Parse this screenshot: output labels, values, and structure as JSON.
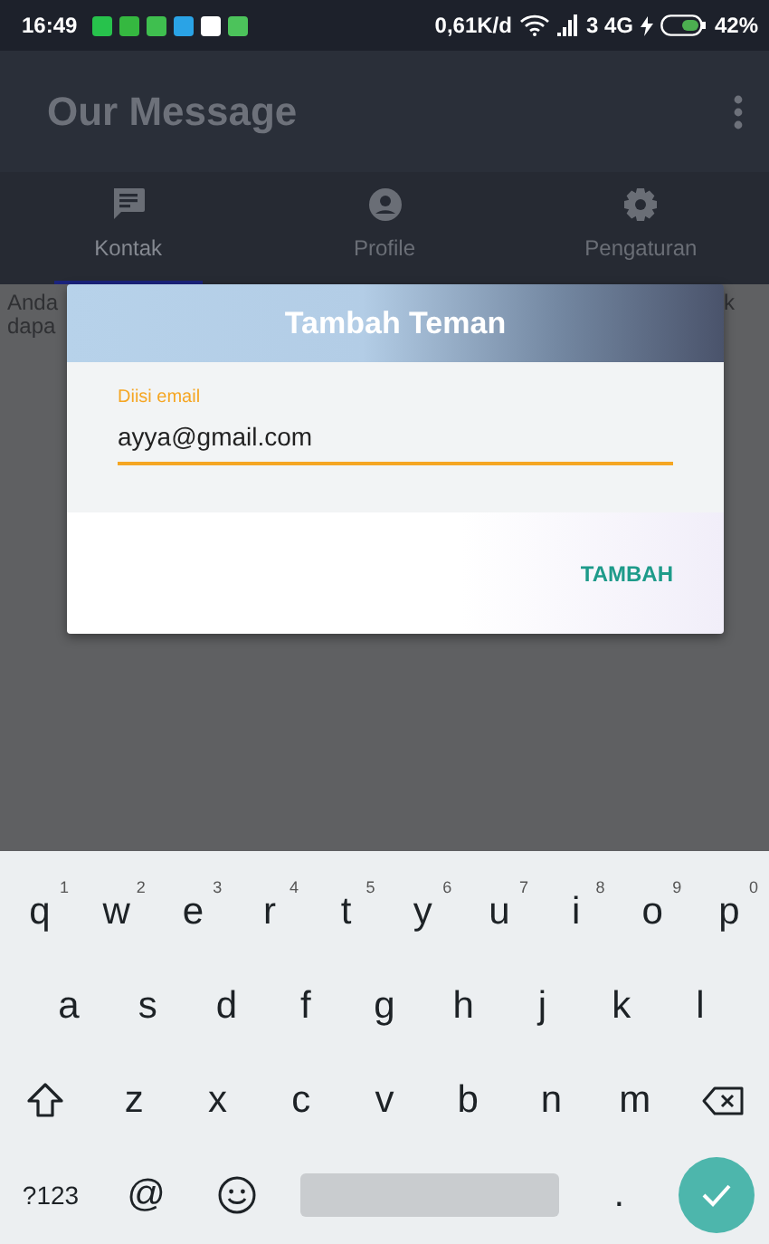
{
  "status_bar": {
    "time": "16:49",
    "network_speed": "0,61K/d",
    "network": "3 4G",
    "battery": "42%"
  },
  "app_bar": {
    "title": "Our Message"
  },
  "tabs": [
    {
      "label": "Kontak",
      "kind": "chat",
      "selected": true
    },
    {
      "label": "Profile",
      "kind": "person",
      "selected": false
    },
    {
      "label": "Pengaturan",
      "kind": "gear",
      "selected": false
    }
  ],
  "content_fragments": {
    "left": [
      "Anda",
      "dapa"
    ],
    "right": "k"
  },
  "dialog": {
    "title": "Tambah Teman",
    "field": {
      "label": "Diisi email",
      "value": "ayya@gmail.com"
    },
    "button": "TAMBAH"
  },
  "keyboard": {
    "rows": [
      [
        {
          "kind": "letter",
          "label": "q",
          "hint": "1"
        },
        {
          "kind": "letter",
          "label": "w",
          "hint": "2"
        },
        {
          "kind": "letter",
          "label": "e",
          "hint": "3"
        },
        {
          "kind": "letter",
          "label": "r",
          "hint": "4"
        },
        {
          "kind": "letter",
          "label": "t",
          "hint": "5"
        },
        {
          "kind": "letter",
          "label": "y",
          "hint": "6"
        },
        {
          "kind": "letter",
          "label": "u",
          "hint": "7"
        },
        {
          "kind": "letter",
          "label": "i",
          "hint": "8"
        },
        {
          "kind": "letter",
          "label": "o",
          "hint": "9"
        },
        {
          "kind": "letter",
          "label": "p",
          "hint": "0"
        }
      ],
      [
        {
          "kind": "letter",
          "label": "a"
        },
        {
          "kind": "letter",
          "label": "s"
        },
        {
          "kind": "letter",
          "label": "d"
        },
        {
          "kind": "letter",
          "label": "f"
        },
        {
          "kind": "letter",
          "label": "g"
        },
        {
          "kind": "letter",
          "label": "h"
        },
        {
          "kind": "letter",
          "label": "j"
        },
        {
          "kind": "letter",
          "label": "k"
        },
        {
          "kind": "letter",
          "label": "l"
        }
      ],
      [
        {
          "kind": "shift"
        },
        {
          "kind": "letter",
          "label": "z"
        },
        {
          "kind": "letter",
          "label": "x"
        },
        {
          "kind": "letter",
          "label": "c"
        },
        {
          "kind": "letter",
          "label": "v"
        },
        {
          "kind": "letter",
          "label": "b"
        },
        {
          "kind": "letter",
          "label": "n"
        },
        {
          "kind": "letter",
          "label": "m"
        },
        {
          "kind": "backspace"
        }
      ],
      [
        {
          "kind": "symbol",
          "label": "?123"
        },
        {
          "kind": "letter",
          "label": "@"
        },
        {
          "kind": "emoji"
        },
        {
          "kind": "space"
        },
        {
          "kind": "letter",
          "label": "."
        },
        {
          "kind": "enter"
        }
      ]
    ]
  }
}
